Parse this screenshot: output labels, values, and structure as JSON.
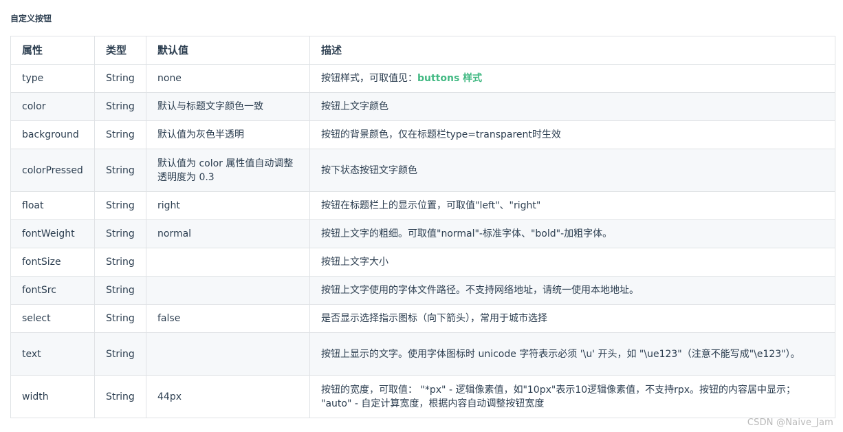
{
  "section_title": "自定义按钮",
  "table": {
    "headers": [
      "属性",
      "类型",
      "默认值",
      "描述"
    ],
    "rows": [
      {
        "name": "type",
        "type": "String",
        "default": "none",
        "desc": "按钮样式，可取值见：",
        "link": "buttons 样式"
      },
      {
        "name": "color",
        "type": "String",
        "default": "默认与标题文字颜色一致",
        "desc": "按钮上文字颜色"
      },
      {
        "name": "background",
        "type": "String",
        "default": "默认值为灰色半透明",
        "desc": "按钮的背景颜色，仅在标题栏type=transparent时生效"
      },
      {
        "name": "colorPressed",
        "type": "String",
        "default": "默认值为 color 属性值自动调整透明度为 0.3",
        "desc": "按下状态按钮文字颜色"
      },
      {
        "name": "float",
        "type": "String",
        "default": "right",
        "desc": "按钮在标题栏上的显示位置，可取值\"left\"、\"right\""
      },
      {
        "name": "fontWeight",
        "type": "String",
        "default": "normal",
        "desc": "按钮上文字的粗细。可取值\"normal\"-标准字体、\"bold\"-加粗字体。"
      },
      {
        "name": "fontSize",
        "type": "String",
        "default": "",
        "desc": "按钮上文字大小"
      },
      {
        "name": "fontSrc",
        "type": "String",
        "default": "",
        "desc": "按钮上文字使用的字体文件路径。不支持网络地址，请统一使用本地地址。"
      },
      {
        "name": "select",
        "type": "String",
        "default": "false",
        "desc": "是否显示选择指示图标（向下箭头），常用于城市选择"
      },
      {
        "name": "text",
        "type": "String",
        "default": "",
        "desc": "按钮上显示的文字。使用字体图标时 unicode 字符表示必须 '\\u' 开头，如 \"\\ue123\"（注意不能写成\"\\e123\"）。"
      },
      {
        "name": "width",
        "type": "String",
        "default": "44px",
        "desc": "按钮的宽度，可取值： \"*px\" - 逻辑像素值，如\"10px\"表示10逻辑像素值，不支持rpx。按钮的内容居中显示； \"auto\" - 自定计算宽度，根据内容自动调整按钮宽度"
      }
    ]
  },
  "watermark": "CSDN @Naive_Jam",
  "colors": {
    "link": "#42b983",
    "border": "#dfe2e5",
    "stripe": "#f6f8fa",
    "text": "#2c3e50"
  }
}
